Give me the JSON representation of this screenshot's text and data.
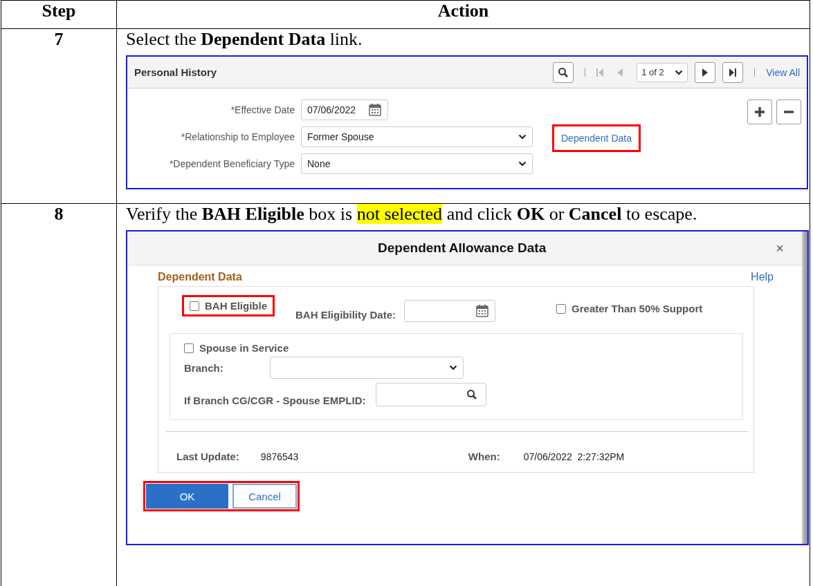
{
  "table": {
    "columns": [
      "Step",
      "Action"
    ],
    "rows": [
      {
        "step": "7",
        "instruction": [
          {
            "text": "Select the ",
            "bold": false,
            "highlight": false
          },
          {
            "text": "Dependent Data",
            "bold": true,
            "highlight": false
          },
          {
            "text": " link.",
            "bold": false,
            "highlight": false
          }
        ],
        "screen": {
          "kind": "personal_history",
          "title": "Personal History",
          "pager": "1 of 2",
          "view_all": "View All",
          "fields": [
            {
              "label": "*Effective Date",
              "value": "07/06/2022",
              "kind": "date"
            },
            {
              "label": "*Relationship to Employee",
              "value": "Former Spouse",
              "kind": "select"
            },
            {
              "label": "*Dependent Beneficiary Type",
              "value": "None",
              "kind": "select"
            }
          ],
          "link": {
            "text": "Dependent Data",
            "highlighted": true
          }
        }
      },
      {
        "step": "8",
        "instruction": [
          {
            "text": "Verify the ",
            "bold": false,
            "highlight": false
          },
          {
            "text": "BAH Eligible",
            "bold": true,
            "highlight": false
          },
          {
            "text": " box is ",
            "bold": false,
            "highlight": false
          },
          {
            "text": "not selected",
            "bold": false,
            "highlight": true
          },
          {
            "text": " and click ",
            "bold": false,
            "highlight": false
          },
          {
            "text": "OK",
            "bold": true,
            "highlight": false
          },
          {
            "text": " or ",
            "bold": false,
            "highlight": false
          },
          {
            "text": "Cancel",
            "bold": true,
            "highlight": false
          },
          {
            "text": " to escape.",
            "bold": false,
            "highlight": false
          }
        ],
        "screen": {
          "kind": "dialog",
          "title": "Dependent Allowance Data",
          "close": "×",
          "section": "Dependent Data",
          "help": "Help",
          "bah_eligible": {
            "label": "BAH Eligible",
            "checked": false,
            "highlighted": true
          },
          "bah_date_label": "BAH Eligibility Date:",
          "support": {
            "label": "Greater Than 50% Support",
            "checked": false
          },
          "spouse_in_service": {
            "label": "Spouse in Service",
            "checked": false
          },
          "branch_label": "Branch:",
          "emplid_label": "If Branch CG/CGR - Spouse EMPLID:",
          "last_update_label": "Last Update:",
          "last_update": "9876543",
          "when_label": "When:",
          "when": "07/06/2022  2:27:32PM",
          "buttons": [
            {
              "label": "OK",
              "kind": "primary"
            },
            {
              "label": "Cancel",
              "kind": "secondary"
            }
          ],
          "buttons_highlighted": true
        }
      }
    ]
  }
}
